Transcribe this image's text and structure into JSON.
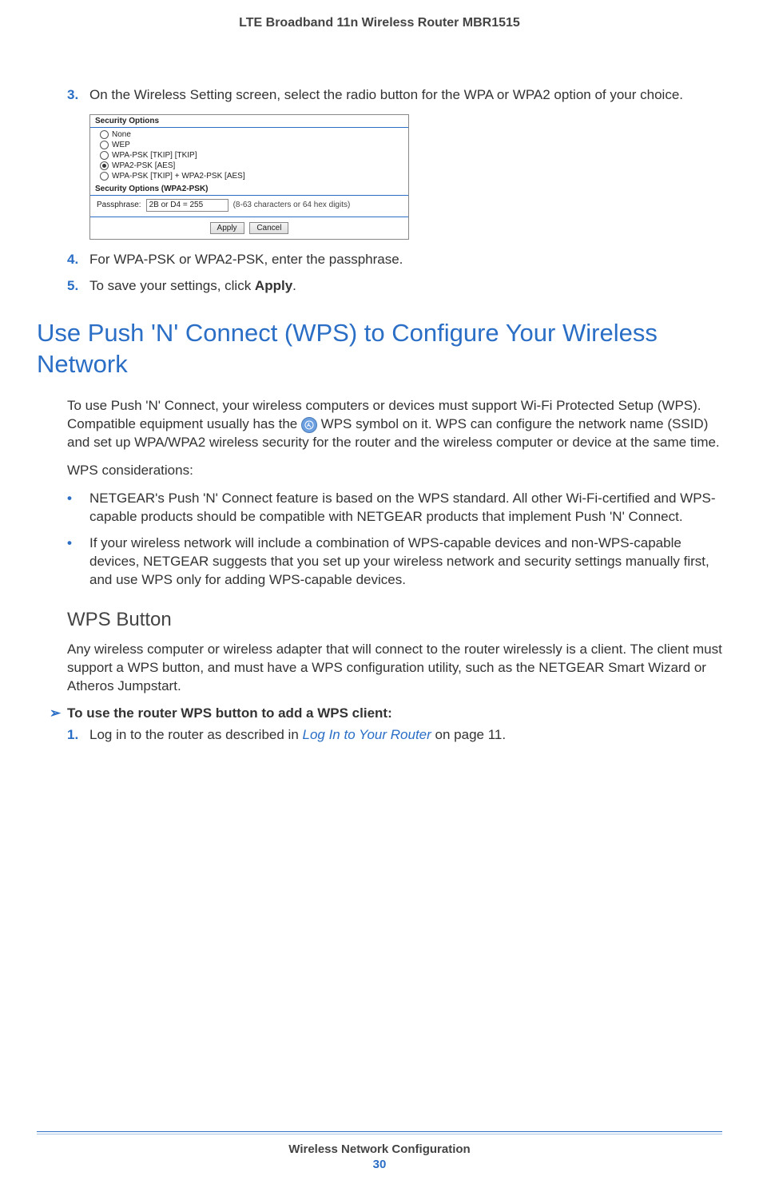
{
  "header": {
    "title": "LTE Broadband 11n Wireless Router MBR1515"
  },
  "steps": {
    "s3": {
      "num": "3.",
      "text": "On the Wireless Setting screen, select the radio button for the WPA or WPA2 option of your choice."
    },
    "s4": {
      "num": "4.",
      "text": "For WPA-PSK or WPA2-PSK, enter the passphrase."
    },
    "s5": {
      "num": "5.",
      "text_a": "To save your settings, click ",
      "bold": "Apply",
      "text_b": "."
    }
  },
  "securityPanel": {
    "optionsHeader": "Security Options",
    "options": [
      {
        "label": "None",
        "selected": false
      },
      {
        "label": "WEP",
        "selected": false
      },
      {
        "label": "WPA-PSK [TKIP] [TKIP]",
        "selected": false
      },
      {
        "label": "WPA2-PSK [AES]",
        "selected": true
      },
      {
        "label": "WPA-PSK [TKIP] + WPA2-PSK [AES]",
        "selected": false
      }
    ],
    "passHeader": "Security Options (WPA2-PSK)",
    "passLabel": "Passphrase:",
    "passValue": "2B or D4 = 255",
    "passHint": "(8-63 characters or 64 hex digits)",
    "applyBtn": "Apply",
    "cancelBtn": "Cancel"
  },
  "sections": {
    "wpsHeading": "Use Push 'N' Connect (WPS) to Configure Your Wireless Network",
    "wpsIntro_a": "To use Push 'N' Connect, your wireless computers or devices must support Wi-Fi Protected Setup (WPS). Compatible equipment usually has the ",
    "wpsIntro_b": " WPS symbol on it. WPS can configure the network name (SSID) and set up WPA/WPA2 wireless security for the router and the wireless computer or device at the same time.",
    "considerLabel": "WPS considerations:",
    "bullets": [
      "NETGEAR's Push 'N' Connect feature is based on the WPS standard. All other Wi-Fi-certified and WPS-capable products should be compatible with NETGEAR products that implement Push 'N' Connect.",
      "If your wireless network will include a combination of WPS-capable devices and non-WPS-capable devices, NETGEAR suggests that you set up your wireless network and security settings manually first, and use WPS only for adding WPS-capable devices."
    ],
    "wpsButtonHeading": "WPS Button",
    "wpsButtonPara": "Any wireless computer or wireless adapter that will connect to the router wirelessly is a client. The client must support a WPS button, and must have a WPS configuration utility, such as the NETGEAR Smart Wizard or Atheros Jumpstart.",
    "todoArrow": "➢",
    "todoLabel": "To use the router WPS button to add a WPS client:",
    "todoStep1": {
      "num": "1.",
      "text_a": "Log in to the router as described in ",
      "link": "Log In to Your Router",
      "text_b": " on page 11."
    }
  },
  "footer": {
    "title": "Wireless Network Configuration",
    "page": "30"
  }
}
